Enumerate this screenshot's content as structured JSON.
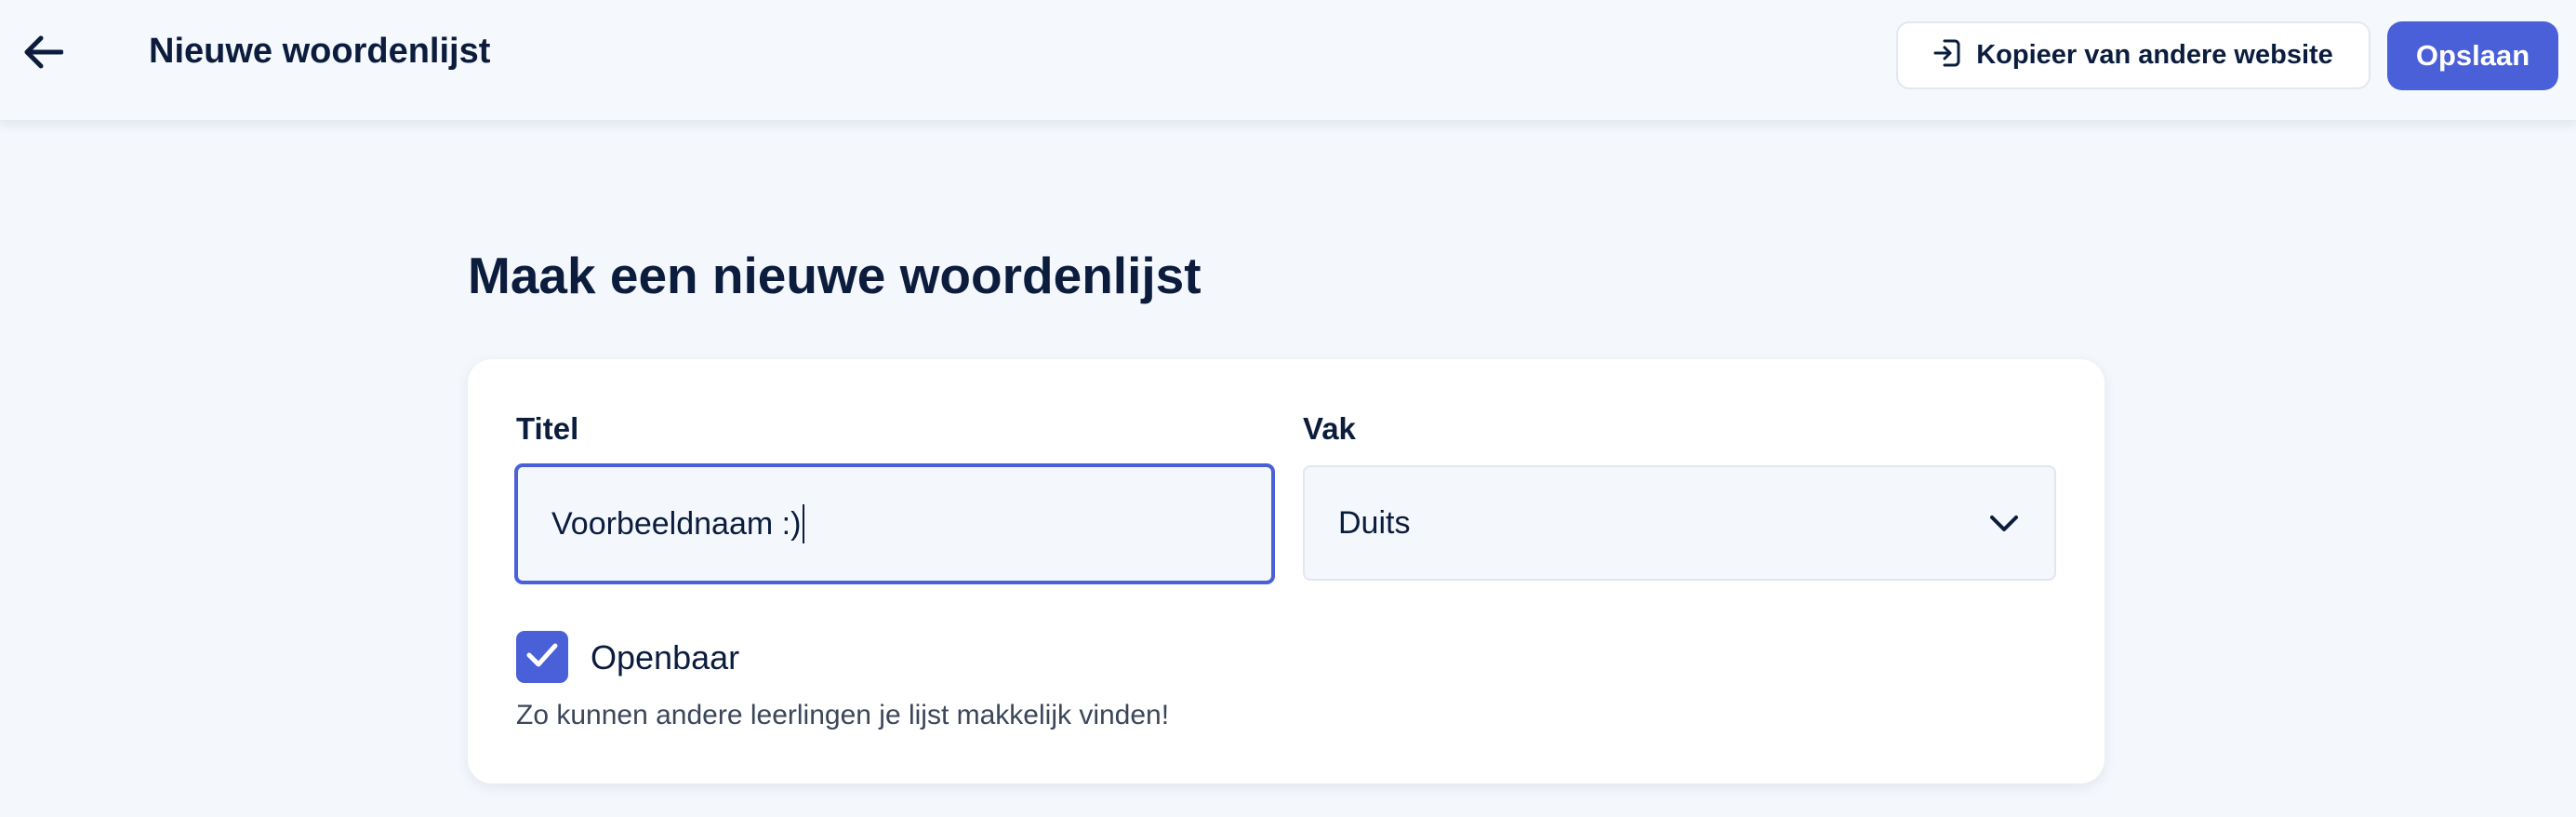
{
  "header": {
    "back_icon": "arrow-left-icon",
    "title": "Nieuwe woordenlijst",
    "copy_button": {
      "icon": "import-icon",
      "label": "Kopieer van andere website"
    },
    "save_button_label": "Opslaan"
  },
  "main": {
    "heading": "Maak een nieuwe woordenlijst",
    "form": {
      "title_label": "Titel",
      "title_value": "Voorbeeldnaam :)",
      "subject_label": "Vak",
      "subject_value": "Duits",
      "subject_icon": "chevron-down-icon",
      "public_checked": true,
      "public_label": "Openbaar",
      "public_hint": "Zo kunnen andere leerlingen je lijst makkelijk vinden!"
    }
  },
  "colors": {
    "accent": "#4a60d9",
    "text": "#0b1c3d",
    "background": "#f4f7fc"
  }
}
